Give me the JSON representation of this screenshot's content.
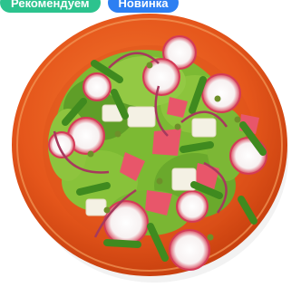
{
  "badges": {
    "recommend": {
      "label": "Рекомендуем",
      "color": "#2cc38e"
    },
    "new": {
      "label": "Новинка",
      "color": "#2d7ff2"
    }
  },
  "image": {
    "subject": "salad-plate"
  }
}
